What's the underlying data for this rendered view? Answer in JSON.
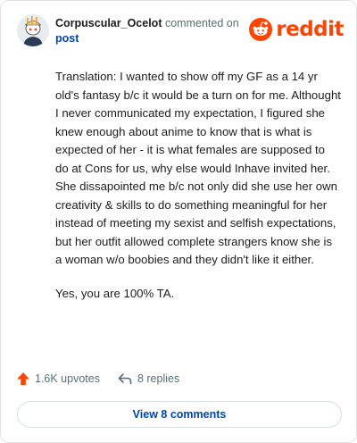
{
  "header": {
    "username": "Corpuscular_Ocelot",
    "action_text": "commented on",
    "post_link": "post",
    "logo_text": "reddit"
  },
  "comment": {
    "paragraphs": [
      "Translation: I wanted to show off my GF as a 14 yr old's fantasy b/c it would be a turn on for me. Althought I never communicated my expectation, I figured she knew enough about anime to know that is what is expected of her - it is what females are supposed to do at Cons for us, why else would Inhave invited her. She dissapointed me b/c not only did she use her own creativity & skills to do something meaningful for her instead of meeting my sexist and selfish expectations, but her outfit allowed complete strangers know she is a woman w/o boobies and they didn't like it either.",
      "Yes, you are 100% TA."
    ]
  },
  "actions": {
    "upvotes": "1.6K upvotes",
    "replies": "8 replies"
  },
  "footer": {
    "view_comments": "View 8 comments"
  },
  "colors": {
    "brand": "#ff4500",
    "link": "#0045ac",
    "muted": "#576f76"
  },
  "icons": [
    "avatar-icon",
    "reddit-logo-icon",
    "upvote-arrow-icon",
    "reply-arrow-icon"
  ]
}
